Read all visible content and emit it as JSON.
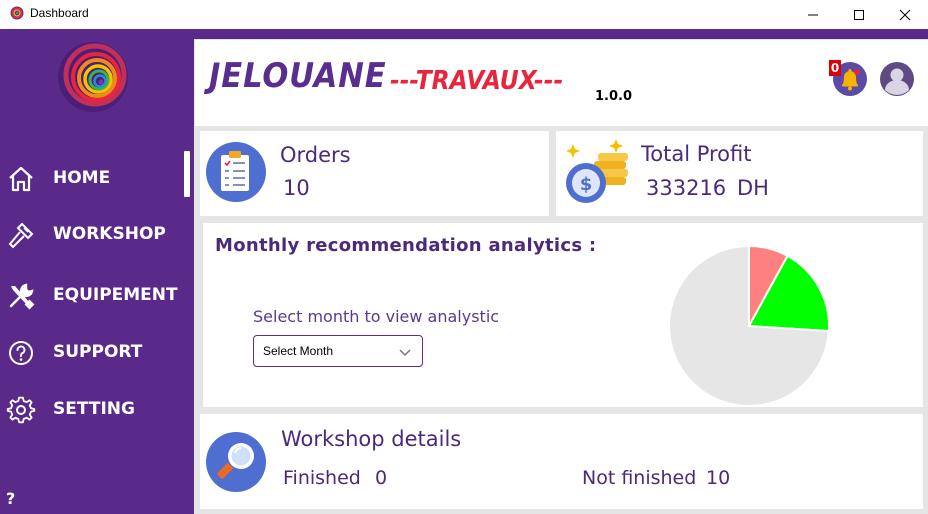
{
  "window": {
    "title": "Dashboard",
    "controls": [
      "minimize-icon",
      "maximize-icon",
      "close-icon"
    ]
  },
  "sidebar": {
    "items": [
      {
        "label": "HOME",
        "icon": "home-icon",
        "active": true
      },
      {
        "label": "WORKSHOP",
        "icon": "hammer-icon",
        "active": false
      },
      {
        "label": "EQUIPEMENT",
        "icon": "tools-icon",
        "active": false
      },
      {
        "label": "SUPPORT",
        "icon": "help-circle-icon",
        "active": false
      },
      {
        "label": "SETTING",
        "icon": "gear-icon",
        "active": false
      }
    ],
    "help_label": "?"
  },
  "header": {
    "brand": "JELOUANE",
    "subtitle": "---TRAVAUX---",
    "version": "1.0.0",
    "notification_count": "0"
  },
  "stats": {
    "orders": {
      "title": "Orders",
      "value": "10",
      "icon": "clipboard-icon"
    },
    "profit": {
      "title": "Total Profit",
      "value": "333216",
      "unit": "DH",
      "icon": "money-icon"
    }
  },
  "analytics": {
    "title": "Monthly recommendation analytics :",
    "select_label": "Select month to view analystic",
    "select_value": "Select Month",
    "chart_data": {
      "type": "pie",
      "values": [
        8,
        18,
        74
      ],
      "colors": [
        "#ff8080",
        "#00ff00",
        "#e6e6e6"
      ]
    }
  },
  "workshop": {
    "title": "Workshop details",
    "finished_label": "Finished",
    "finished_value": "0",
    "not_finished_label": "Not finished",
    "not_finished_value": "10",
    "icon": "magnifier-icon"
  },
  "colors": {
    "sidebar": "#592a8a",
    "accent_red": "#e8253c",
    "text_purple": "#4b2a7a"
  }
}
